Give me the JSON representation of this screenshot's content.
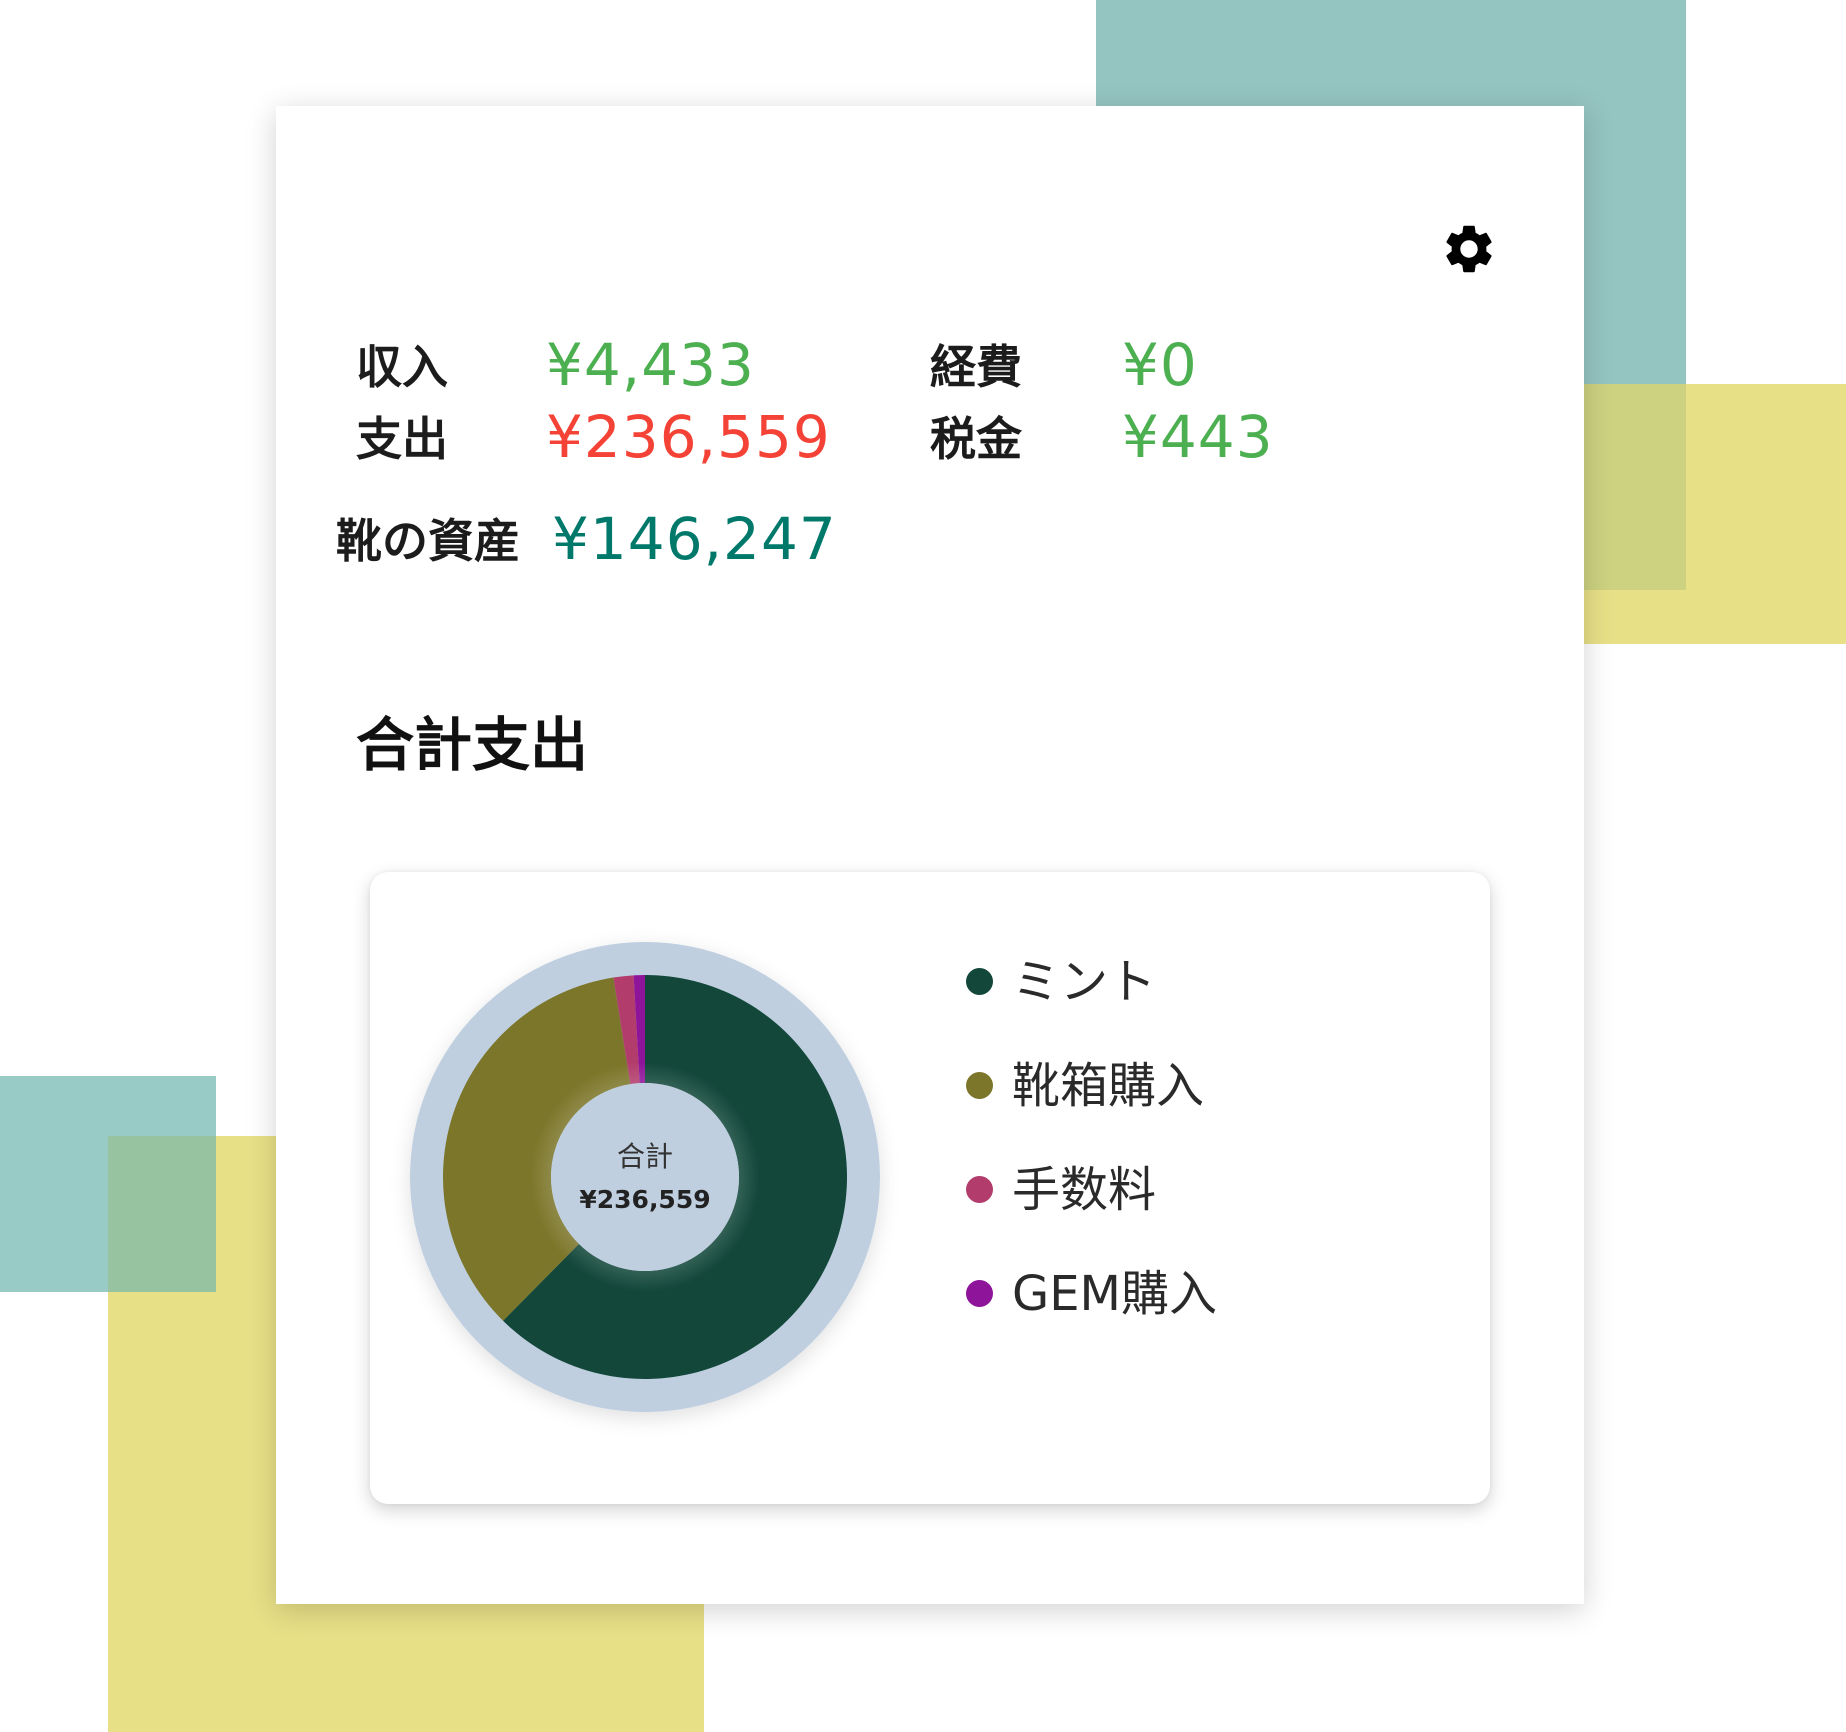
{
  "stats": {
    "income_label": "収入",
    "income_value": "¥4,433",
    "spend_label": "支出",
    "spend_value": "¥236,559",
    "expense_label": "経費",
    "expense_value": "¥0",
    "tax_label": "税金",
    "tax_value": "¥443",
    "assets_label": "靴の資産",
    "assets_value": "¥146,247"
  },
  "section": {
    "title": "合計支出"
  },
  "settings": {
    "icon": "gear-icon"
  },
  "colors": {
    "positive": "#4caf50",
    "negative": "#f44336",
    "assets": "#00796b",
    "donut_ring": "#bfcfe0"
  },
  "chart_data": {
    "type": "pie",
    "center_label": "合計",
    "center_value": "¥236,559",
    "slices": [
      {
        "label": "ミント",
        "value": 0.624,
        "color": "#12473a"
      },
      {
        "label": "靴箱購入",
        "value": 0.351,
        "color": "#7c762a"
      },
      {
        "label": "手数料",
        "value": 0.016,
        "color": "#b23d6c"
      },
      {
        "label": "GEM購入",
        "value": 0.009,
        "color": "#8e149a"
      }
    ]
  }
}
